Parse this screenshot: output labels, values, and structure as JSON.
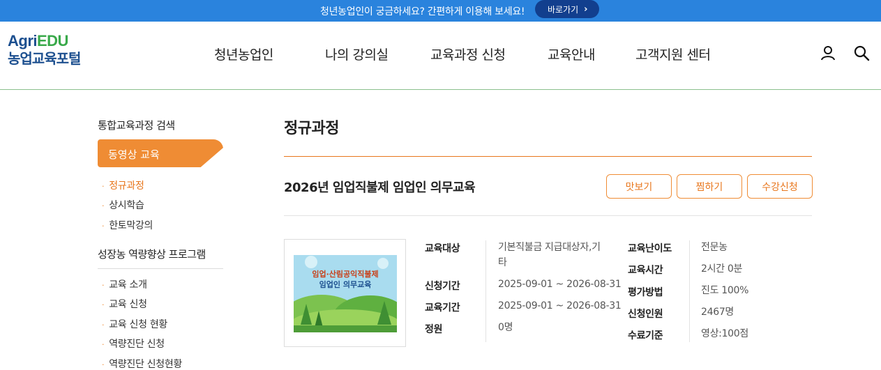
{
  "banner": {
    "text": "청년농업인이 궁금하세요? 간편하게 이용해 보세요!",
    "button_label": "바로가기",
    "bg_color": "#2a83dd"
  },
  "logo": {
    "en_part1": "Agri",
    "en_part2": "EDU",
    "ko": "농업교육포털"
  },
  "gnb": [
    "청년농업인",
    "나의 강의실",
    "교육과정 신청",
    "교육안내",
    "고객지원 센터"
  ],
  "header_icons": [
    "user-icon",
    "search-icon"
  ],
  "lnb": {
    "section1_title": "통합교육과정 검색",
    "active_label": "동영상 교육",
    "sub_items": [
      "정규과정",
      "상시학습",
      "한토막강의"
    ],
    "section2_title": "성장농 역량향상 프로그램",
    "section2_items": [
      "교육 소개",
      "교육 신청",
      "교육 신청 현황",
      "역량진단 신청",
      "역량진단 신청현황"
    ]
  },
  "content": {
    "page_title": "정규과정",
    "course_title": "2026년 임업직불제 임업인 의무교육",
    "buttons": [
      "맛보기",
      "찜하기",
      "수강신청"
    ],
    "thumb_text_line1": "임업·산림공익직불제",
    "thumb_text_line2": "임업인 의무교육",
    "info_left": [
      {
        "label": "교육대상",
        "value_line1": "기본직불금 지급대상자,기",
        "value_line2": "타"
      },
      {
        "label": "신청기간",
        "value": "2025-09-01 ~ 2026-08-31"
      },
      {
        "label": "교육기간",
        "value": "2025-09-01 ~ 2026-08-31"
      },
      {
        "label": "정원",
        "value": "0명"
      }
    ],
    "info_right": [
      {
        "label": "교육난이도",
        "value": "전문농"
      },
      {
        "label": "교육시간",
        "value": "2시간 0분"
      },
      {
        "label": "평가방법",
        "value": "진도 100%"
      },
      {
        "label": "신청인원",
        "value": "2467명"
      },
      {
        "label": "수료기준",
        "value": "영상:100점"
      }
    ]
  },
  "colors": {
    "accent": "#ef8c34",
    "brand_blue": "#1c4f8f",
    "brand_green": "#39a94a"
  }
}
